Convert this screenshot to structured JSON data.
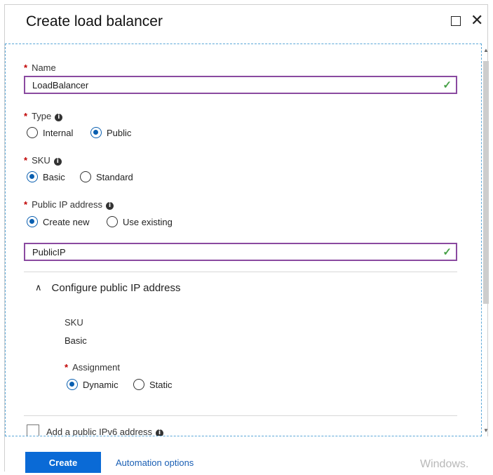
{
  "window": {
    "title": "Create load balancer"
  },
  "form": {
    "required_mark": "*",
    "info_glyph": "i",
    "name": {
      "label": "Name",
      "value": "LoadBalancer"
    },
    "type": {
      "label": "Type",
      "options": [
        "Internal",
        "Public"
      ],
      "selected": "Public"
    },
    "sku": {
      "label": "SKU",
      "options": [
        "Basic",
        "Standard"
      ],
      "selected": "Basic"
    },
    "public_ip": {
      "label": "Public IP address",
      "options": [
        "Create new",
        "Use existing"
      ],
      "selected": "Create new",
      "value": "PublicIP"
    },
    "configure_section": {
      "title": "Configure public IP address",
      "expanded": true,
      "sku_label": "SKU",
      "sku_value": "Basic",
      "assignment": {
        "label": "Assignment",
        "options": [
          "Dynamic",
          "Static"
        ],
        "selected": "Dynamic"
      }
    },
    "ipv6_checkbox": {
      "label": "Add a public IPv6 address",
      "checked": false
    }
  },
  "footer": {
    "create_label": "Create",
    "automation_label": "Automation options",
    "watermark": "Windows."
  },
  "colors": {
    "accent": "#0a6ad6",
    "focus_border": "#8a4aa0",
    "valid": "#46a046",
    "required": "#c00000"
  },
  "icons": {
    "valid": "check-icon",
    "info": "info-icon",
    "collapse": "chevron-up-icon",
    "maximize": "maximize-icon",
    "close": "close-icon"
  }
}
